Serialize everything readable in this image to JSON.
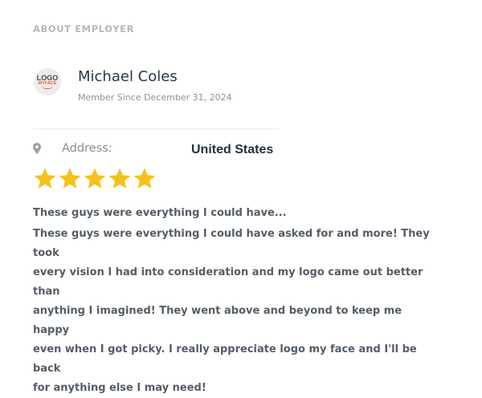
{
  "section": {
    "title": "ABOUT EMPLOYER"
  },
  "employer": {
    "logo_text_top": "LOGO",
    "logo_text_bottom": "MYFACE",
    "name": "Michael Coles",
    "member_since": "Member Since December 31, 2024"
  },
  "address": {
    "icon": "map-pin-icon",
    "label": "Address:",
    "value": "United States"
  },
  "rating": {
    "stars": 5,
    "max": 5,
    "color": "#f5c21b"
  },
  "review": {
    "title": "These guys were everything I could have...",
    "lines": [
      "These guys were everything I could have asked for and more! They took",
      "every vision I had into consideration and my logo came out better than",
      "anything I imagined! They went above and beyond to keep me happy",
      "even when I got picky. I really appreciate logo my face and I'll be back",
      "for anything else I may need!"
    ]
  }
}
